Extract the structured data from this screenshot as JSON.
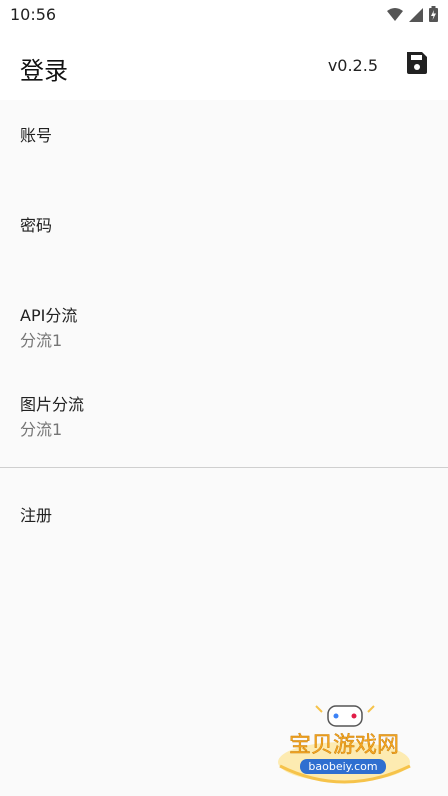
{
  "status_bar": {
    "time": "10:56",
    "icons": [
      "wifi-icon",
      "cellular-signal-icon",
      "battery-charging-icon"
    ]
  },
  "app_bar": {
    "title": "登录",
    "version": "v0.2.5",
    "save_icon": "save-icon"
  },
  "preferences": [
    {
      "title": "账号",
      "summary": ""
    },
    {
      "title": "密码",
      "summary": ""
    },
    {
      "title": "API分流",
      "summary": "分流1"
    },
    {
      "title": "图片分流",
      "summary": "分流1"
    }
  ],
  "register": {
    "title": "注册"
  },
  "watermark": {
    "text": "宝贝游戏网",
    "url": "baobeiy.com"
  },
  "colors": {
    "background": "#fafafa",
    "app_bar": "#ffffff",
    "summary_text": "#757575",
    "divider": "#cfcfcf"
  }
}
